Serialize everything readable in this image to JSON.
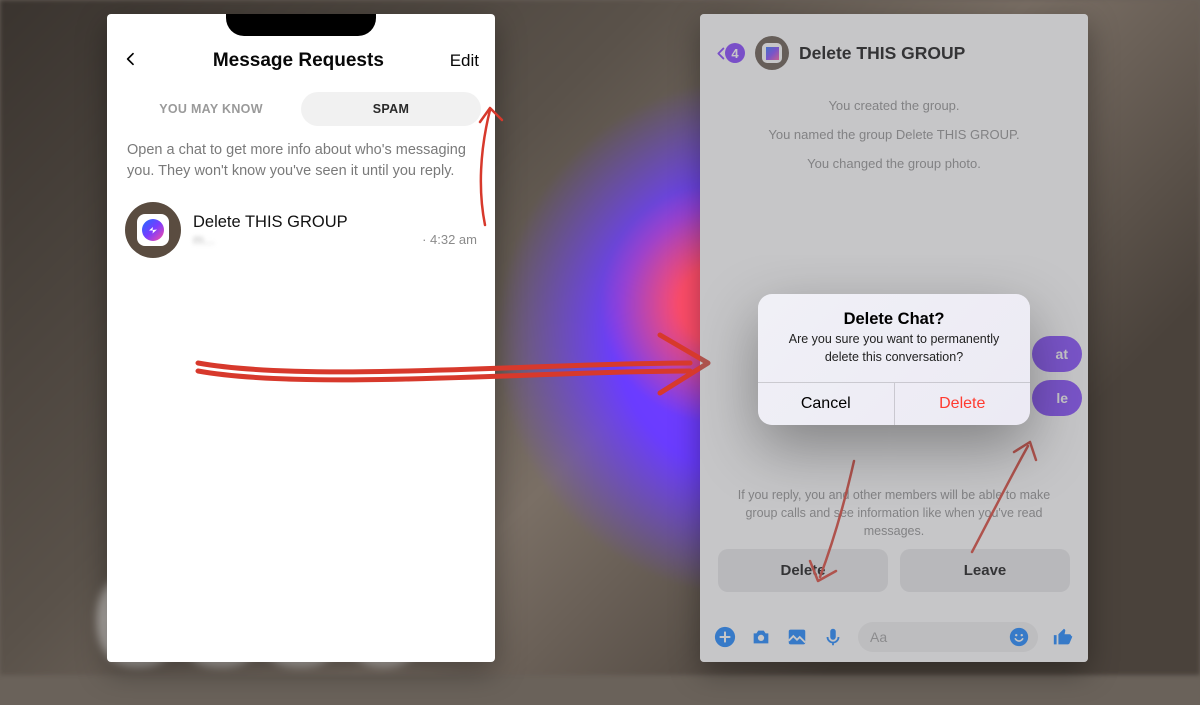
{
  "left": {
    "title": "Message Requests",
    "edit": "Edit",
    "tabs": {
      "know": "YOU MAY KNOW",
      "spam": "SPAM"
    },
    "helper": "Open a chat to get more info about who's messaging you. They won't know you've seen it until you reply.",
    "chat": {
      "title": "Delete THIS GROUP",
      "time": "· 4:32 am",
      "snippet": "m..."
    }
  },
  "right": {
    "badge": "4",
    "title": "Delete THIS GROUP",
    "sys": [
      "You created the group.",
      "You named the group Delete THIS GROUP.",
      "You changed the group photo."
    ],
    "under_labels": {
      "a": "at",
      "b": "le"
    },
    "reply_note": "If you reply, you and other members will be able to make group calls and see information like when you've read messages.",
    "btn_delete": "Delete",
    "btn_leave": "Leave",
    "composer_placeholder": "Aa"
  },
  "alert": {
    "title": "Delete Chat?",
    "msg": "Are you sure you want to permanently delete this conversation?",
    "cancel": "Cancel",
    "delete": "Delete"
  }
}
